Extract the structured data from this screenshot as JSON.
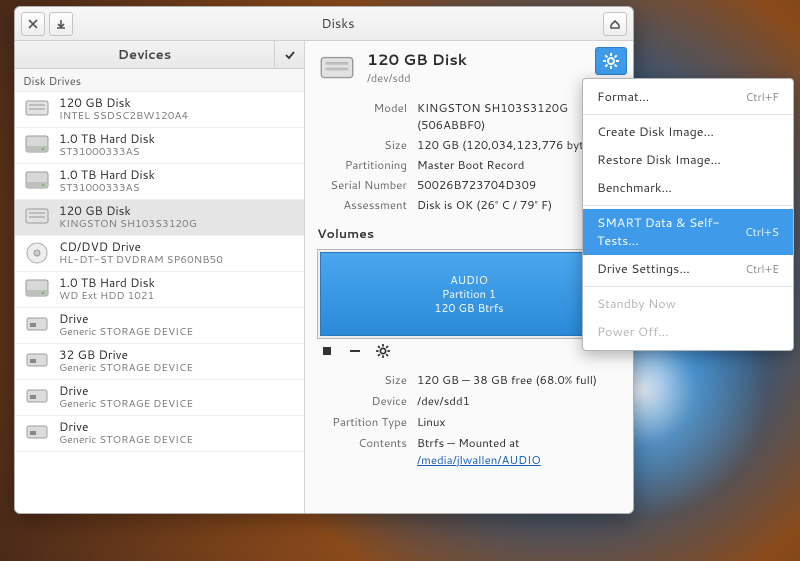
{
  "window": {
    "title": "Disks"
  },
  "sidebar": {
    "header": "Devices",
    "category": "Disk Drives",
    "items": [
      {
        "line1": "120 GB Disk",
        "line2": "INTEL SSDSC2BW120A4",
        "icon": "ssd"
      },
      {
        "line1": "1.0 TB Hard Disk",
        "line2": "ST31000333AS",
        "icon": "hdd"
      },
      {
        "line1": "1.0 TB Hard Disk",
        "line2": "ST31000333AS",
        "icon": "hdd"
      },
      {
        "line1": "120 GB Disk",
        "line2": "KINGSTON SH103S3120G",
        "icon": "ssd",
        "selected": true
      },
      {
        "line1": "CD/DVD Drive",
        "line2": "HL-DT-ST DVDRAM SP60NB50",
        "icon": "optical"
      },
      {
        "line1": "1.0 TB Hard Disk",
        "line2": "WD Ext HDD 1021",
        "icon": "hdd"
      },
      {
        "line1": "Drive",
        "line2": "Generic STORAGE DEVICE",
        "icon": "usb"
      },
      {
        "line1": "32 GB Drive",
        "line2": "Generic STORAGE DEVICE",
        "icon": "usb"
      },
      {
        "line1": "Drive",
        "line2": "Generic STORAGE DEVICE",
        "icon": "usb"
      },
      {
        "line1": "Drive",
        "line2": "Generic STORAGE DEVICE",
        "icon": "usb"
      }
    ]
  },
  "disk": {
    "title": "120 GB Disk",
    "device": "/dev/sdd",
    "model_label": "Model",
    "model": "KINGSTON SH103S3120G (506ABBF0)",
    "size_label": "Size",
    "size": "120 GB (120,034,123,776 bytes)",
    "part_label": "Partitioning",
    "partitioning": "Master Boot Record",
    "serial_label": "Serial Number",
    "serial": "50026B723704D309",
    "assess_label": "Assessment",
    "assessment": "Disk is OK (26° C / 79° F)"
  },
  "volumes": {
    "label": "Volumes",
    "partition_name": "AUDIO",
    "partition_sub1": "Partition 1",
    "partition_sub2": "120 GB Btrfs"
  },
  "voldetail": {
    "size_label": "Size",
    "size": "120 GB — 38 GB free (68.0% full)",
    "device_label": "Device",
    "device": "/dev/sdd1",
    "pt_label": "Partition Type",
    "pt": "Linux",
    "contents_label": "Contents",
    "contents_prefix": "Btrfs — Mounted at ",
    "mount": "/media/jlwallen/AUDIO"
  },
  "menu": {
    "format": "Format…",
    "format_accel": "Ctrl+F",
    "create_img": "Create Disk Image…",
    "restore_img": "Restore Disk Image…",
    "benchmark": "Benchmark…",
    "smart": "SMART Data & Self-Tests…",
    "smart_accel": "Ctrl+S",
    "drive_settings": "Drive Settings…",
    "drive_settings_accel": "Ctrl+E",
    "standby": "Standby Now",
    "poweroff": "Power Off…"
  }
}
